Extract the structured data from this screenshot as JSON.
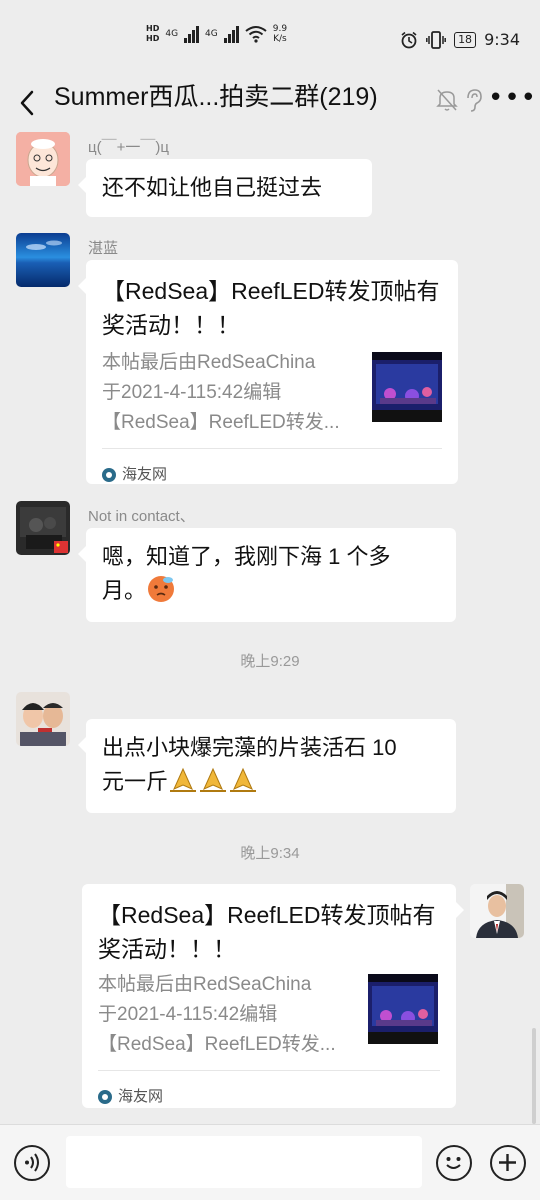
{
  "status_bar": {
    "net_speed_value": "9.9",
    "net_speed_unit": "K/s",
    "signal_1": "4G",
    "signal_2": "4G",
    "hd_1": "HD",
    "hd_2": "HD",
    "battery": "18",
    "time": "9:34"
  },
  "header": {
    "title": "Summer西瓜...拍卖二群(219)"
  },
  "messages": [
    {
      "sender": "ц(￣+一￣)ц",
      "text": "还不如让他自己挺过去"
    },
    {
      "sender": "湛蓝",
      "card": {
        "title": "【RedSea】ReefLED转发顶帖有奖活动！！！",
        "desc_lines": [
          "本帖最后由RedSeaChina",
          "于2021-4-115:42编辑",
          "【RedSea】ReefLED转发..."
        ],
        "source": "海友网"
      }
    },
    {
      "sender": "Not in contact、",
      "text_line1": "嗯，知道了，我刚下海 1 个多",
      "text_line2": "月。"
    },
    {
      "timestamp": "晚上9:29"
    },
    {
      "text_line1": "出点小块爆完藻的片装活石 10",
      "text_line2": "元一斤"
    },
    {
      "timestamp": "晚上9:34"
    },
    {
      "card": {
        "title": "【RedSea】ReefLED转发顶帖有奖活动！！！",
        "desc_lines": [
          "本帖最后由RedSeaChina",
          "于2021-4-115:42编辑",
          "【RedSea】ReefLED转发..."
        ],
        "source": "海友网"
      }
    }
  ],
  "input_bar": {
    "placeholder": ""
  }
}
